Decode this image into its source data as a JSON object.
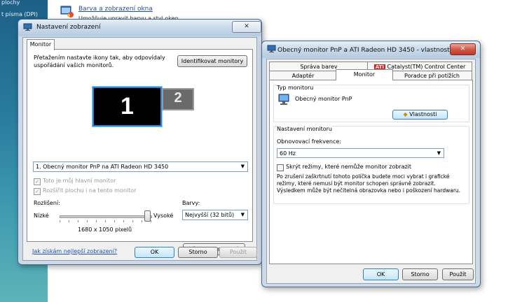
{
  "sidebar": {
    "items": [
      "plochy",
      "t písma (DPI)"
    ]
  },
  "control_panel": {
    "item_title": "Barva a zobrazení okna",
    "item_desc": "Umožňuje upravit barvu a styl oken"
  },
  "display_settings": {
    "title": "Nastavení zobrazení",
    "close": "✕",
    "tab": "Monitor",
    "instruction": "Přetažením nastavte ikony tak, aby odpovídaly uspořádání vašich monitorů.",
    "identify_button": "Identifikovat monitory",
    "monitor1": "1",
    "monitor2": "2",
    "monitor_select": "1. Obecný monitor PnP na ATI Radeon HD 3450",
    "primary_checkbox": "Toto je můj hlavní monitor",
    "extend_checkbox": "Rozšířit plochu i na tento monitor",
    "resolution_label": "Rozlišení:",
    "low_label": "Nízké",
    "high_label": "Vysoké",
    "resolution_value": "1680 x 1050 pixelů",
    "resolution_level": 0.95,
    "colors_label": "Barvy:",
    "colors_select": "Nejvyšší (32 bitů)",
    "help_link": "Jak získám nejlepší zobrazení?",
    "advanced_button": "Upřesnit nastavení...",
    "ok": "OK",
    "cancel": "Storno",
    "apply": "Použít"
  },
  "properties": {
    "title": "Obecný monitor PnP a ATI Radeon HD 3450 - vlastnosti",
    "close": "✕",
    "tabs_row1": [
      "Správa barev",
      "Catalyst(TM) Control Center"
    ],
    "tabs_row2": [
      "Adaptér",
      "Monitor",
      "Poradce při potížích"
    ],
    "monitor_type_label": "Typ monitoru",
    "monitor_name": "Obecný monitor PnP",
    "properties_button": "Vlastnosti",
    "monitor_settings_label": "Nastavení monitoru",
    "refresh_label": "Obnovovací frekvence:",
    "refresh_value": "60 Hz",
    "hide_modes_checkbox": "Skrýt režimy, které nemůže monitor zobrazit",
    "warning_text": "Po zrušení zaškrtnutí tohoto políčka budete moci vybrat i grafické režimy, které nemusí být monitor schopen správně zobrazit. Výsledkem může být nečitelná obrazovka nebo i poškození hardwaru.",
    "ok": "OK",
    "cancel": "Storno",
    "apply": "Použít"
  },
  "colors": {
    "ati_red": "#d8201c",
    "monitor1_border": "#1b8ce0",
    "link": "#1f4fa8"
  }
}
